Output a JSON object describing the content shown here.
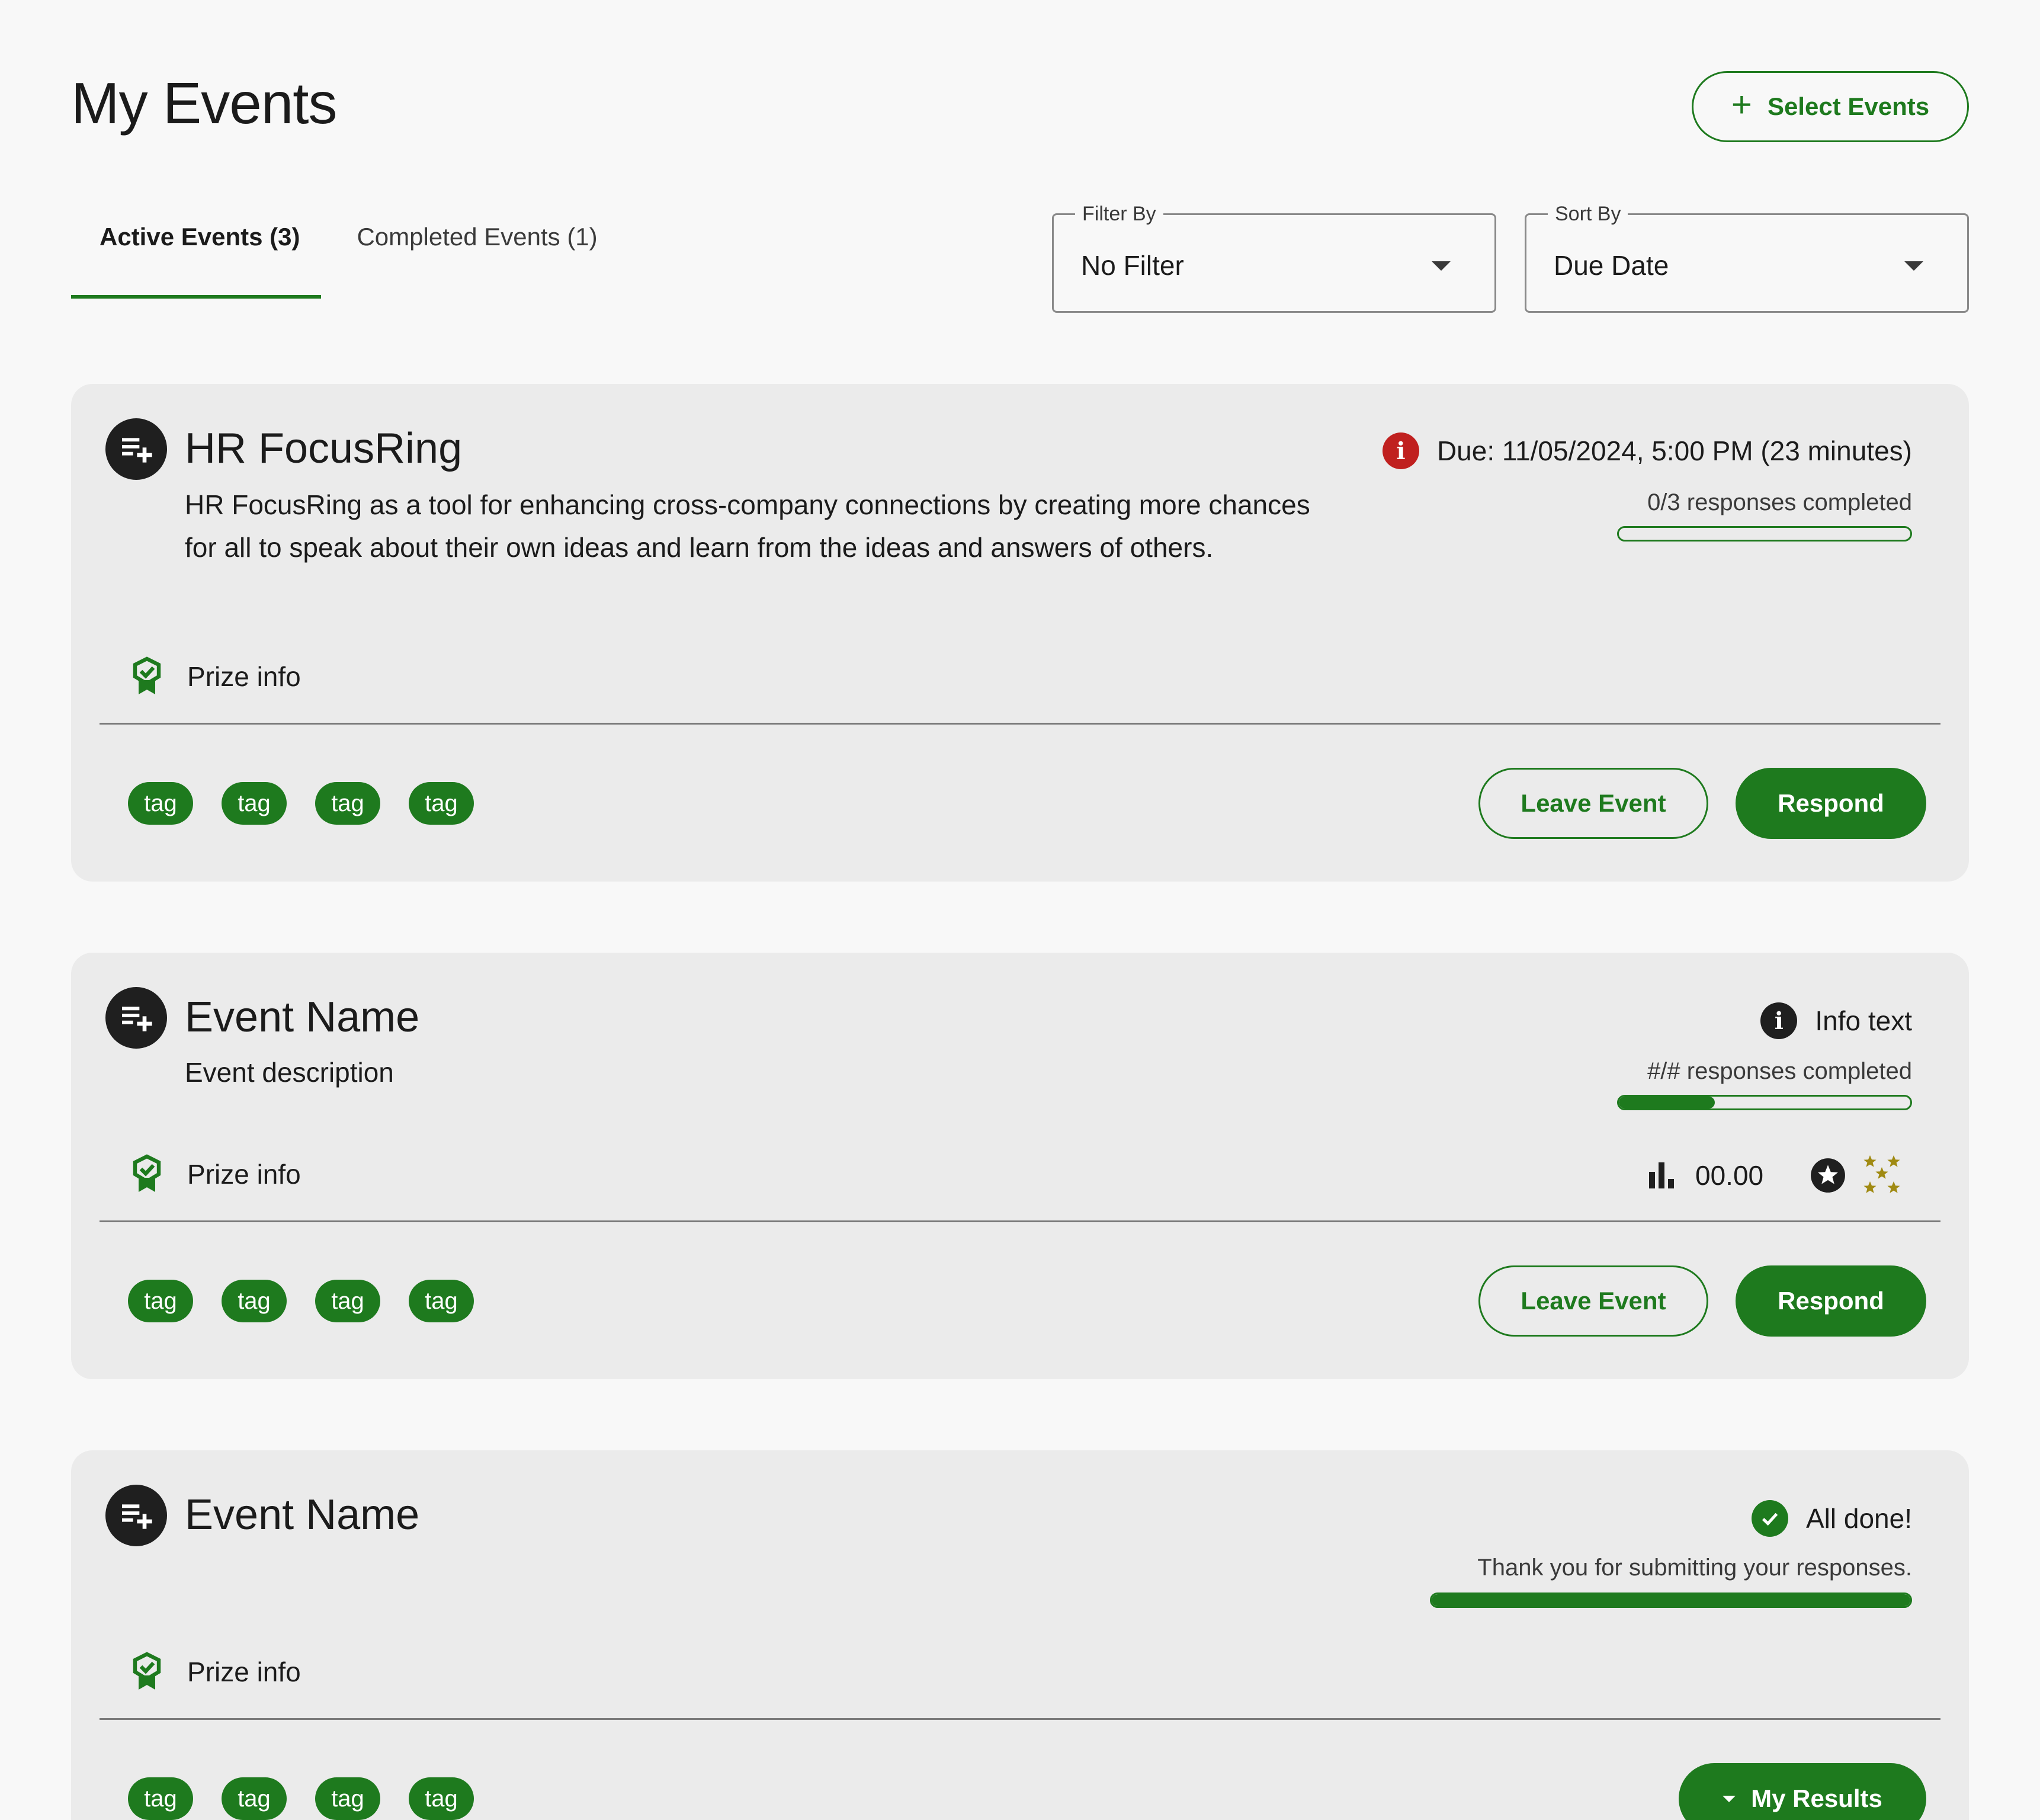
{
  "page": {
    "title": "My Events"
  },
  "header": {
    "select_events_label": "Select Events"
  },
  "tabs": [
    {
      "label": "Active Events (3)",
      "active": true
    },
    {
      "label": "Completed Events (1)",
      "active": false
    }
  ],
  "filter": {
    "legend": "Filter By",
    "value": "No Filter"
  },
  "sort": {
    "legend": "Sort By",
    "value": "Due Date"
  },
  "colors": {
    "accent": "#1e7a1e",
    "alert": "#c0201f",
    "card_bg": "#ebebeb",
    "page_bg": "#f8f8f8",
    "stars": "#a08a12"
  },
  "events": [
    {
      "name": "HR FocusRing",
      "description": "HR FocusRing as a tool for enhancing cross-company connections by creating more chances for all to speak about their own ideas and learn from the ideas and answers of others.",
      "status_text": "Due: 11/05/2024, 5:00 PM (23 minutes)",
      "status_icon": "alert-icon",
      "progress_label": "0/3 responses completed",
      "progress": 0,
      "prize_label": "Prize info",
      "tags": [
        "tag",
        "tag",
        "tag",
        "tag"
      ],
      "leave_label": "Leave Event",
      "respond_label": "Respond"
    },
    {
      "name": "Event Name",
      "description": "Event description",
      "status_text": "Info text",
      "status_icon": "info-icon",
      "progress_label": "#/# responses completed",
      "progress": 0.33,
      "prize_label": "Prize info",
      "score": "00.00",
      "tags": [
        "tag",
        "tag",
        "tag",
        "tag"
      ],
      "leave_label": "Leave Event",
      "respond_label": "Respond"
    },
    {
      "name": "Event Name",
      "status_text": "All done!",
      "status_icon": "check-circle-icon",
      "progress_label": "Thank you for submitting your responses.",
      "progress": 1,
      "prize_label": "Prize info",
      "tags": [
        "tag",
        "tag",
        "tag",
        "tag"
      ],
      "results_label": "My Results"
    }
  ]
}
